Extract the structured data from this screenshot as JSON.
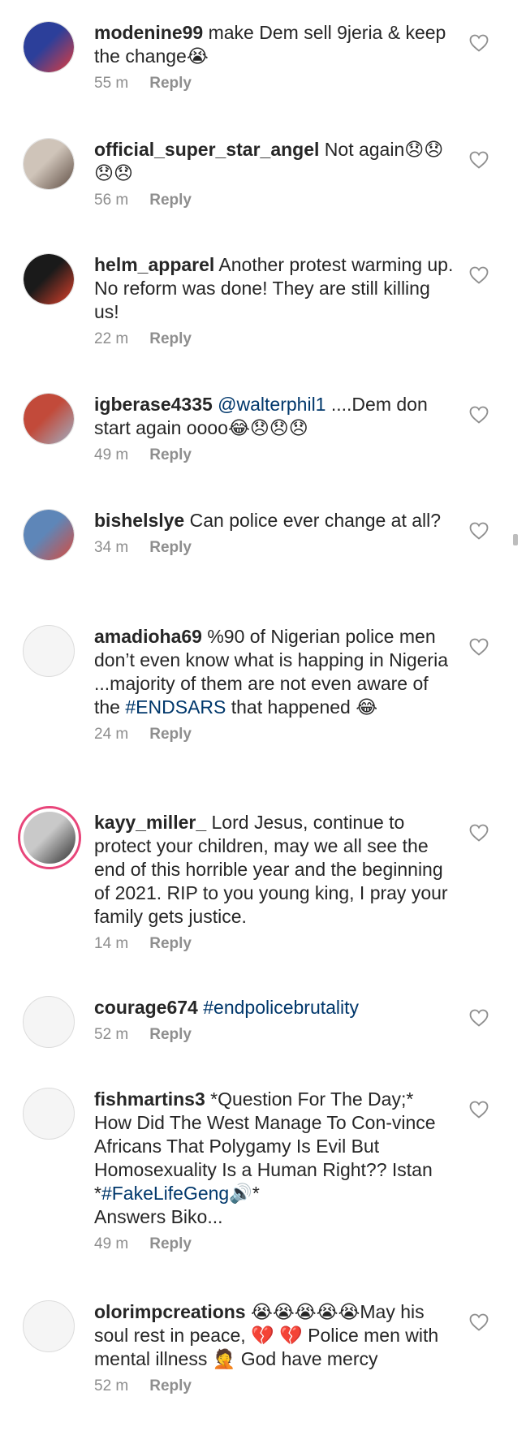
{
  "comments": [
    {
      "username": "modenine99",
      "segments": [
        {
          "text": " make Dem sell 9jeria & keep the change😭"
        }
      ],
      "time": "55 m",
      "reply": "Reply",
      "avatar": "photo",
      "colors": [
        "#2c3f9a",
        "#e33c3c"
      ]
    },
    {
      "username": "official_super_star_angel",
      "segments": [
        {
          "text": " Not again😞😞😞😞"
        }
      ],
      "time": "56 m",
      "reply": "Reply",
      "avatar": "photo",
      "colors": [
        "#cfc4b9",
        "#5f4e44"
      ]
    },
    {
      "username": "helm_apparel",
      "segments": [
        {
          "text": " Another protest warming up. No reform was done! They are still killing us!"
        }
      ],
      "time": "22 m",
      "reply": "Reply",
      "avatar": "photo",
      "colors": [
        "#1a1a1a",
        "#e0412b"
      ]
    },
    {
      "username": "igberase4335",
      "segments": [
        {
          "text": " "
        },
        {
          "text": "@walterphil1",
          "link": true
        },
        {
          "text": " ....Dem don start again oooo😂😞😞😞"
        }
      ],
      "time": "49 m",
      "reply": "Reply",
      "avatar": "photo",
      "colors": [
        "#c24a3a",
        "#9fb0c4"
      ]
    },
    {
      "username": "bishelslye",
      "segments": [
        {
          "text": " Can police ever change at all?"
        }
      ],
      "time": "34 m",
      "reply": "Reply",
      "avatar": "photo",
      "colors": [
        "#5e86b8",
        "#d94a3c"
      ]
    },
    {
      "username": "amadioha69",
      "segments": [
        {
          "text": " %90 of Nigerian police men don’t even know what is happing in Nigeria ...majority of them are not even aware of the "
        },
        {
          "text": "#ENDSARS",
          "link": true
        },
        {
          "text": " that happened 😂"
        }
      ],
      "time": "24 m",
      "reply": "Reply",
      "avatar": "empty"
    },
    {
      "username": "kayy_miller_",
      "segments": [
        {
          "text": " Lord Jesus, continue to protect your children, may we all see the end of this horrible year and the beginning of 2021. RIP to you young king, I pray your family gets justice."
        }
      ],
      "time": "14 m",
      "reply": "Reply",
      "avatar": "story",
      "colors": [
        "#c9c9c9",
        "#2f2f2f"
      ]
    },
    {
      "username": "courage674",
      "segments": [
        {
          "text": " "
        },
        {
          "text": "#endpolicebrutality",
          "link": true
        }
      ],
      "time": "52 m",
      "reply": "Reply",
      "avatar": "empty"
    },
    {
      "username": "fishmartins3",
      "segments": [
        {
          "text": " *Question For The Day;* How Did The West Manage To Con-vince Africans That Polygamy Is Evil But Homosexuality Is a Human Right?? Istan *"
        },
        {
          "text": "#FakeLifeGeng",
          "link": true
        },
        {
          "text": "🔊*\nAnswers Biko..."
        }
      ],
      "time": "49 m",
      "reply": "Reply",
      "avatar": "empty"
    },
    {
      "username": "olorimpcreations",
      "segments": [
        {
          "text": " 😭😭😭😭😭May his soul rest in peace, 💔 💔 Police men with mental illness 🤦 God have mercy"
        }
      ],
      "time": "52 m",
      "reply": "Reply",
      "avatar": "empty"
    }
  ]
}
